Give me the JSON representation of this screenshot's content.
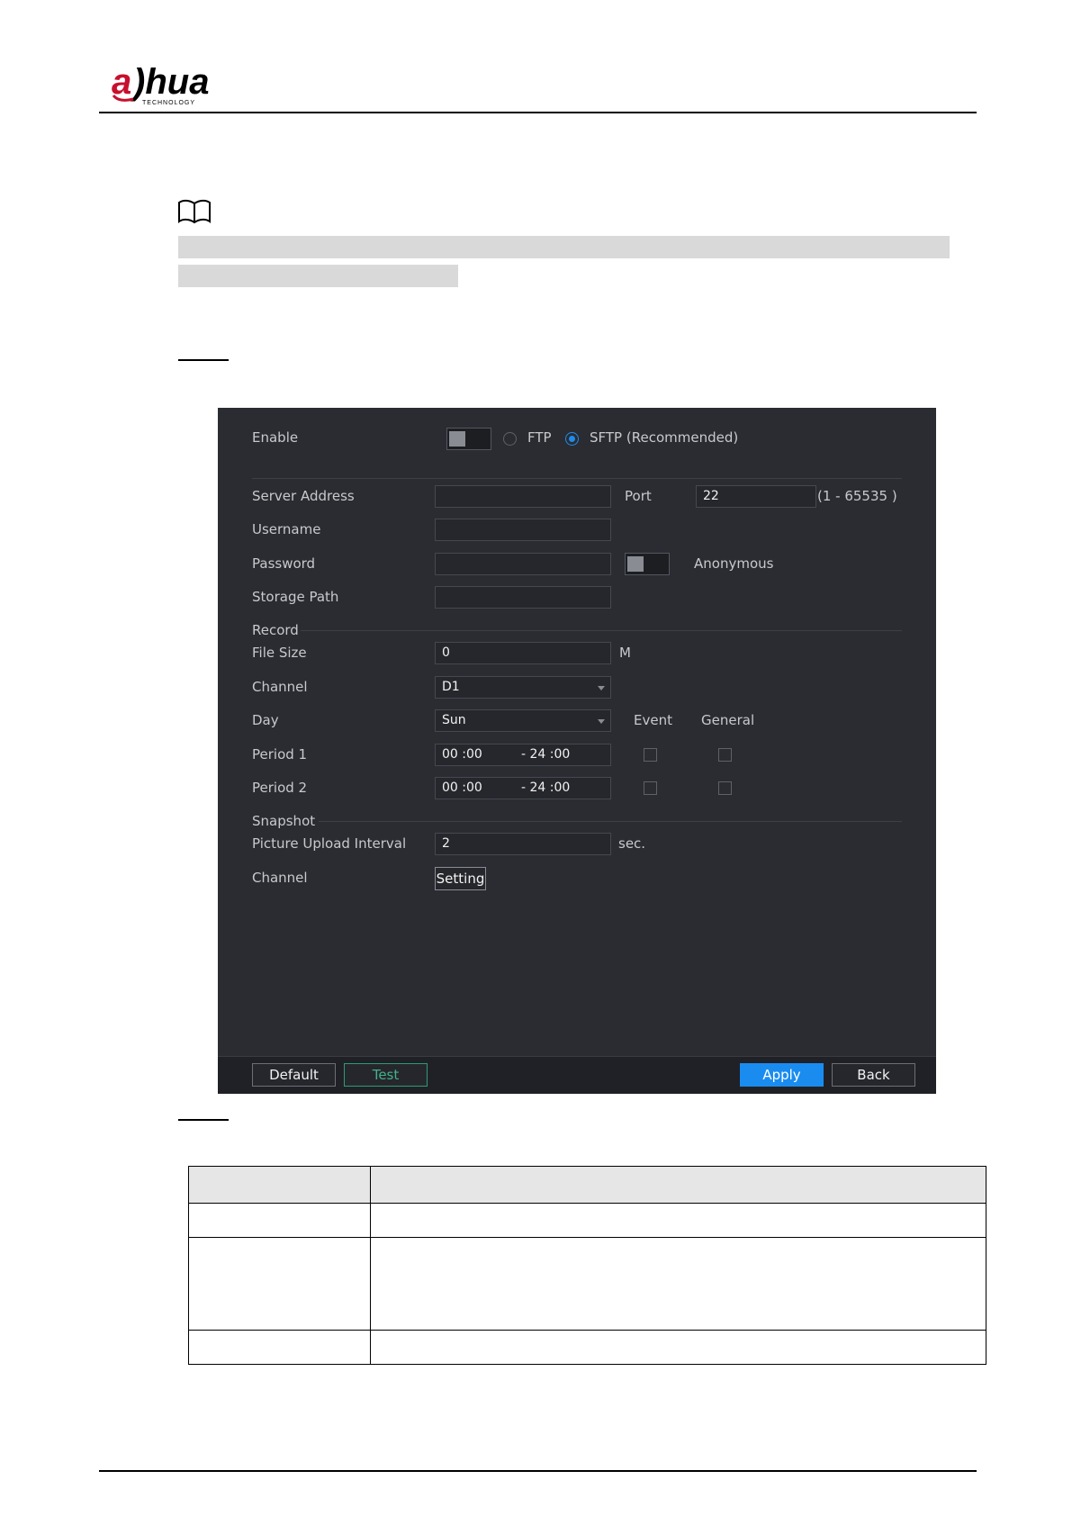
{
  "brand": {
    "logo_name": "dahua",
    "logo_sub": "TECHNOLOGY"
  },
  "panel": {
    "enable_label": "Enable",
    "protocol_ftp": "FTP",
    "protocol_sftp": "SFTP (Recommended)",
    "selected_protocol": "SFTP (Recommended)",
    "server_address_label": "Server Address",
    "server_address_value": "",
    "port_label": "Port",
    "port_value": "22",
    "port_range": "(1 - 65535 )",
    "username_label": "Username",
    "password_label": "Password",
    "anonymous_label": "Anonymous",
    "storage_path_label": "Storage Path",
    "record_section": "Record",
    "file_size_label": "File Size",
    "file_size_value": "0",
    "file_size_unit": "M",
    "channel_label": "Channel",
    "channel_value": "D1",
    "day_label": "Day",
    "day_value": "Sun",
    "event_col": "Event",
    "general_col": "General",
    "periods": [
      {
        "label": "Period 1",
        "start": "00 :00",
        "end": "- 24 :00"
      },
      {
        "label": "Period 2",
        "start": "00 :00",
        "end": "- 24 :00"
      }
    ],
    "snapshot_section": "Snapshot",
    "upload_interval_label": "Picture Upload Interval",
    "upload_interval_value": "2",
    "upload_interval_unit": "sec.",
    "snapshot_channel_label": "Channel",
    "setting_button": "Setting",
    "buttons": {
      "default": "Default",
      "test": "Test",
      "apply": "Apply",
      "back": "Back"
    }
  },
  "colors": {
    "panel_bg": "#2a2c32",
    "accent_blue": "#1a8cf0",
    "test_green": "#40b38a"
  }
}
